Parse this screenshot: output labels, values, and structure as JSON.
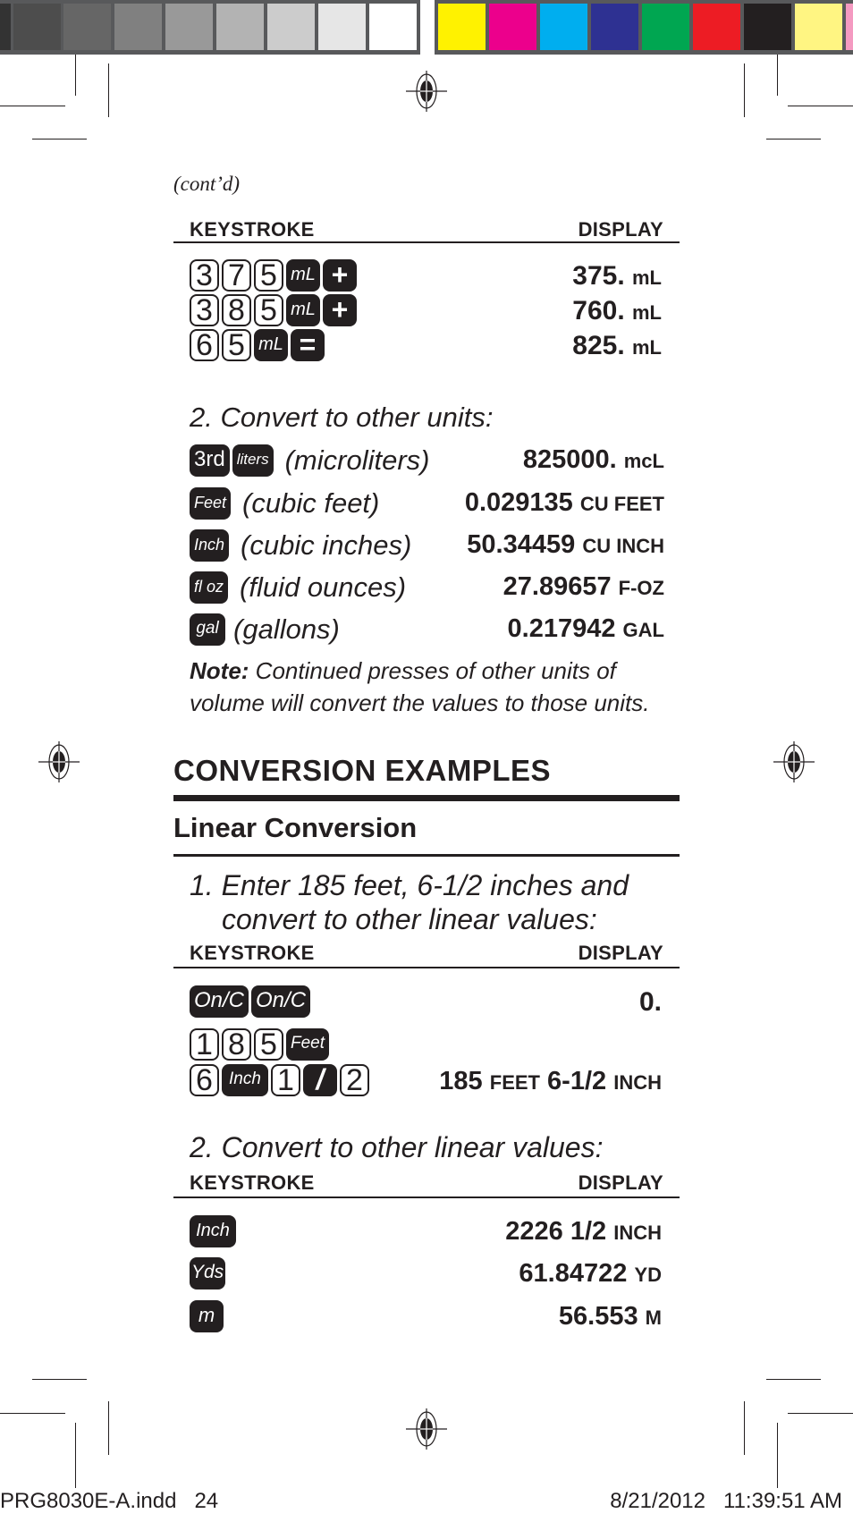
{
  "colorbar": {
    "grays": [
      "#333333",
      "#4d4d4d",
      "#666666",
      "#808080",
      "#999999",
      "#b3b3b3",
      "#cccccc",
      "#e6e6e6",
      "#ffffff"
    ],
    "colors": [
      "#fff200",
      "#ec008c",
      "#00aeef",
      "#2e3192",
      "#00a651",
      "#ed1c24",
      "#231f20",
      "#fff582",
      "#f49ac1"
    ]
  },
  "contd": "(cont’d)",
  "table1": {
    "keystroke_label": "KEYSTROKE",
    "display_label": "DISPLAY",
    "rows": [
      {
        "keys": [
          "3",
          "7",
          "5",
          "mL",
          "+"
        ],
        "value": "375.",
        "unit": "mL"
      },
      {
        "keys": [
          "3",
          "8",
          "5",
          "mL",
          "+"
        ],
        "value": "760.",
        "unit": "mL"
      },
      {
        "keys": [
          "6",
          "5",
          "mL",
          "="
        ],
        "value": "825.",
        "unit": "mL"
      }
    ]
  },
  "step2": {
    "title": "2. Convert to other units:",
    "rows": [
      {
        "keys": [
          "3rd",
          "liters"
        ],
        "desc": "(microliters)",
        "value": "825000.",
        "unit": "mcL"
      },
      {
        "keys": [
          "Feet"
        ],
        "desc": "(cubic feet)",
        "value": "0.029135",
        "unit": "CU FEET"
      },
      {
        "keys": [
          "Inch"
        ],
        "desc": "(cubic inches)",
        "value": "50.34459",
        "unit": "CU INCH"
      },
      {
        "keys": [
          "fl oz"
        ],
        "desc": "(fluid ounces)",
        "value": "27.89657",
        "unit": "F-OZ"
      },
      {
        "keys": [
          "gal"
        ],
        "desc": "(gallons)",
        "value": "0.217942",
        "unit": "GAL"
      }
    ],
    "note_label": "Note:",
    "note_line1": " Continued presses of other units of",
    "note_line2": "volume will convert the values to those units."
  },
  "section": {
    "title": "CONVERSION EXAMPLES",
    "subtitle": "Linear Conversion"
  },
  "linear1": {
    "title_line1": "1. Enter 185 feet, 6-1/2 inches and",
    "title_line2": "convert to other linear values:",
    "keystroke_label": "KEYSTROKE",
    "display_label": "DISPLAY",
    "rows": [
      {
        "keys": [
          "On/C",
          "On/C"
        ],
        "display": "0."
      },
      {
        "keys": [
          "1",
          "8",
          "5",
          "Feet"
        ],
        "display": ""
      },
      {
        "keys": [
          "6",
          "Inch",
          "1",
          "/",
          "2"
        ],
        "display_parts": [
          "185",
          "FEET",
          "6-1/2",
          "INCH"
        ]
      }
    ]
  },
  "linear2": {
    "title": "2. Convert to other linear values:",
    "keystroke_label": "KEYSTROKE",
    "display_label": "DISPLAY",
    "rows": [
      {
        "keys": [
          "Inch"
        ],
        "value": "2226 1/2",
        "unit": "INCH"
      },
      {
        "keys": [
          "Yds"
        ],
        "value": "61.84722",
        "unit": "YD"
      },
      {
        "keys": [
          "m"
        ],
        "value": "56.553",
        "unit": "M"
      }
    ]
  },
  "footer": {
    "file": "PRG8030E-A.indd   24",
    "timestamp": "8/21/2012   11:39:51 AM"
  }
}
